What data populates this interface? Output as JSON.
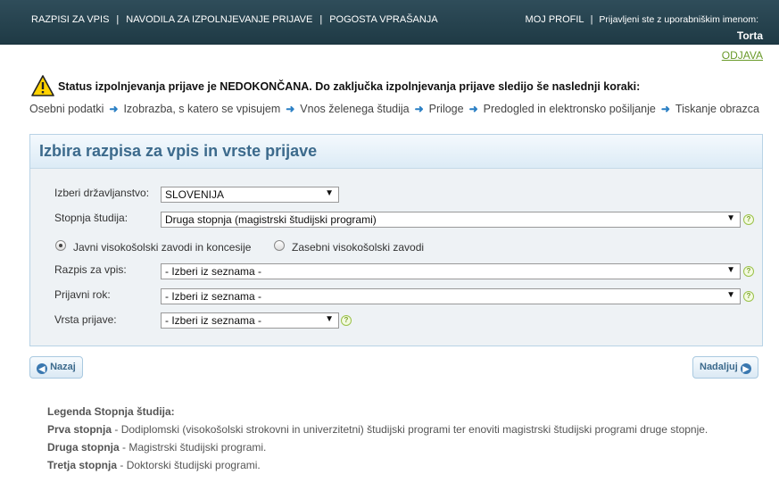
{
  "topnav": {
    "items": [
      "RAZPISI ZA VPIS",
      "NAVODILA ZA IZPOLNJEVANJE PRIJAVE",
      "POGOSTA VPRAŠANJA"
    ],
    "separator": "|"
  },
  "profile": {
    "link": "MOJ PROFIL",
    "separator": "|",
    "logged_in_text": "Prijavljeni ste z uporabniškim imenom:",
    "username": "Torta"
  },
  "logout_label": "ODJAVA",
  "status": {
    "icon": "warning-icon",
    "text": "Status izpolnjevanja prijave je NEDOKONČANA. Do zaključka izpolnjevanja prijave sledijo še naslednji koraki:"
  },
  "steps": [
    "Osebni podatki",
    "Izobrazba, s katero se vpisujem",
    "Vnos želenega študija",
    "Priloge",
    "Predogled in elektronsko pošiljanje",
    "Tiskanje obrazca"
  ],
  "panel": {
    "title": "Izbira razpisa za vpis in vrste prijave",
    "citizenship": {
      "label": "Izberi državljanstvo:",
      "value": "SLOVENIJA"
    },
    "study_level": {
      "label": "Stopnja študija:",
      "value": "Druga stopnja (magistrski študijski programi)"
    },
    "radio_public": {
      "label": "Javni visokošolski zavodi in koncesije",
      "checked": true
    },
    "radio_private": {
      "label": "Zasebni visokošolski zavodi",
      "checked": false
    },
    "tender": {
      "label": "Razpis za vpis:",
      "value": "- Izberi iz seznama -"
    },
    "deadline": {
      "label": "Prijavni rok:",
      "value": "- Izberi iz seznama -"
    },
    "application_type": {
      "label": "Vrsta prijave:",
      "value": "- Izberi iz seznama -"
    },
    "help_symbol": "?",
    "caret_symbol": "▼"
  },
  "buttons": {
    "back": "Nazaj",
    "next": "Nadaljuj"
  },
  "legend": {
    "title": "Legenda Stopnja študija:",
    "items": [
      {
        "term": "Prva stopnja",
        "desc": " - Dodiplomski (visokošolski strokovni in univerzitetni) študijski programi ter enoviti magistrski študijski programi druge stopnje."
      },
      {
        "term": "Druga stopnja",
        "desc": " - Magistrski študijski programi."
      },
      {
        "term": "Tretja stopnja",
        "desc": " - Doktorski študijski programi."
      }
    ]
  },
  "colors": {
    "header_bg": "#1f3a45",
    "accent": "#3c6a8c",
    "link_green": "#6a9a2a",
    "arrow_blue": "#2a7fc4"
  }
}
